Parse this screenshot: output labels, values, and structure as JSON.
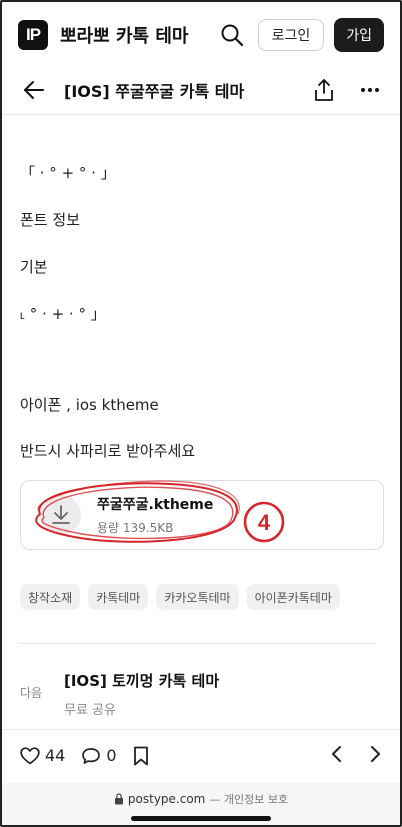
{
  "header": {
    "logo_text": "IP",
    "site_title": "뽀라뽀 카톡 테마",
    "login_label": "로그인",
    "signup_label": "가입"
  },
  "post": {
    "title": "[IOS] 쭈굴쭈굴 카톡 테마",
    "lines": [
      "「 ·  °  +  °  ·  」",
      "폰트 정보",
      "기본",
      "˪ °  ·  +  ·  °  」",
      "아이폰 , ios ktheme",
      "반드시 사파리로 받아주세요"
    ]
  },
  "attachment": {
    "filename": "쭈굴쭈굴.ktheme",
    "size": "용량 139.5KB",
    "annotation_number": "4",
    "annotation_color": "#d6262b"
  },
  "tags": [
    "창작소재",
    "카톡테마",
    "카카오톡테마",
    "아이폰카톡테마"
  ],
  "next_post": {
    "label": "다음",
    "title": "[IOS] 토끼멍 카톡 테마",
    "subtitle": "무료 공유"
  },
  "bottom_bar": {
    "likes": "44",
    "comments": "0"
  },
  "url_bar": {
    "domain": "postype.com",
    "suffix": "— 개인정보 보호"
  }
}
